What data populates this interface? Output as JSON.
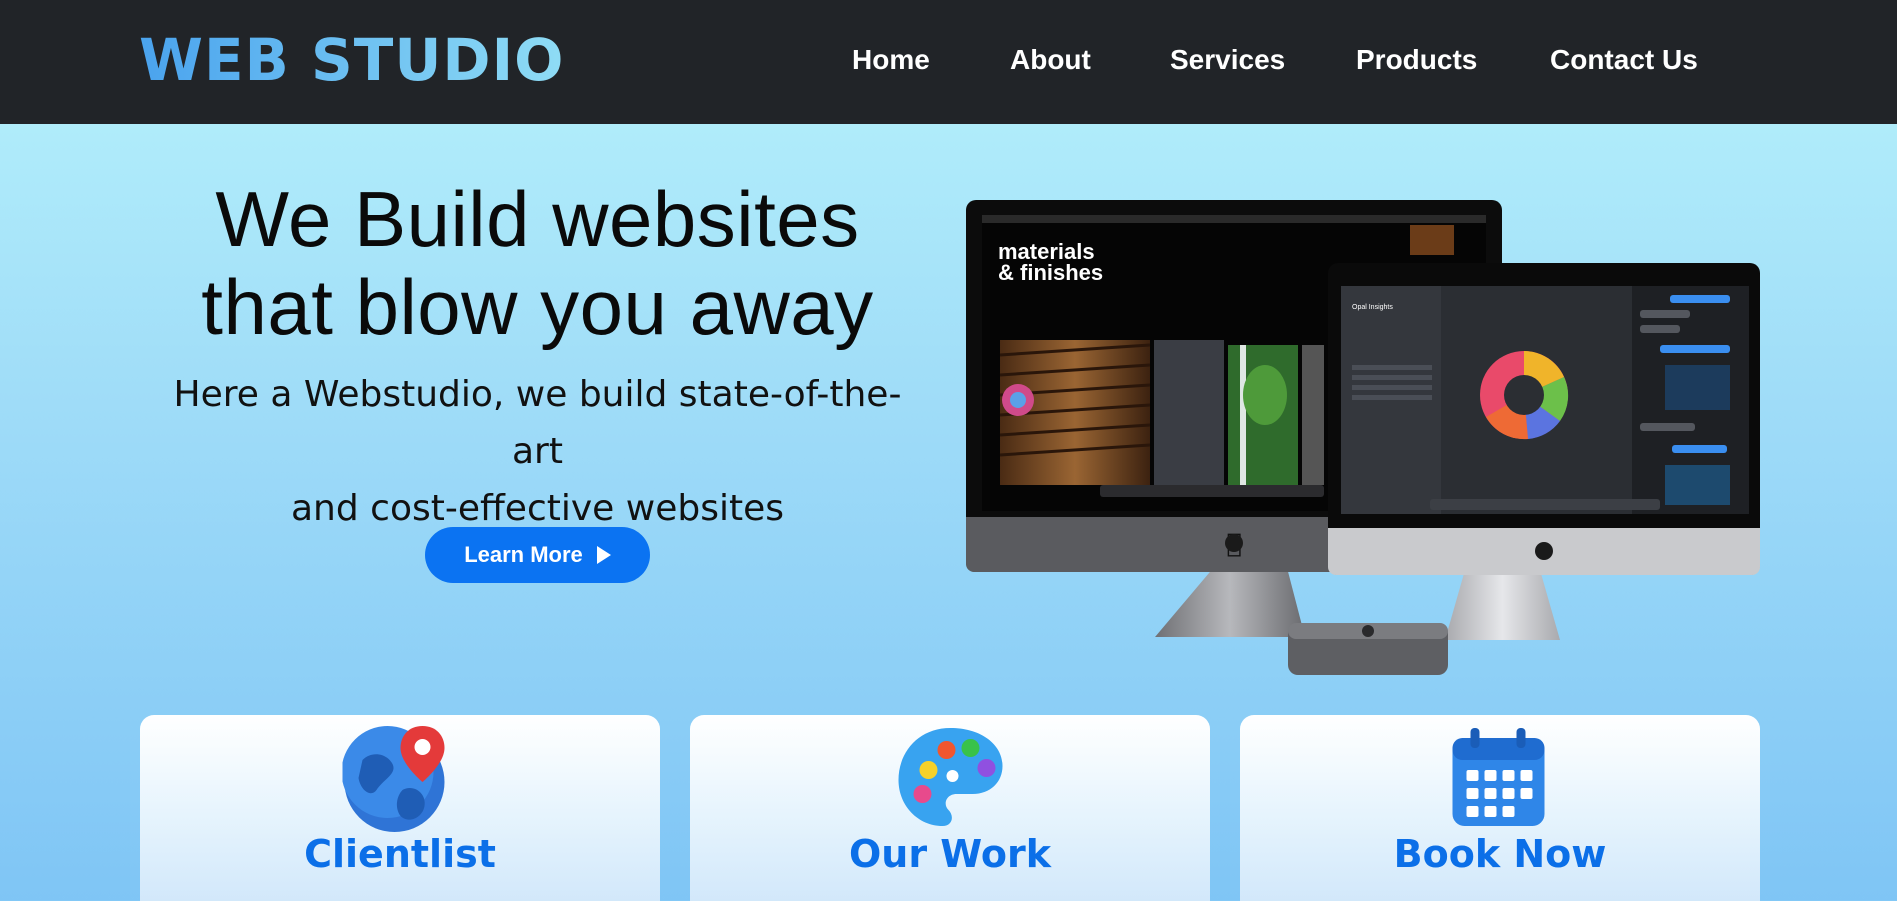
{
  "brand": {
    "name": "WEB STUDIO"
  },
  "nav": {
    "items": [
      {
        "label": "Home"
      },
      {
        "label": "About"
      },
      {
        "label": "Services"
      },
      {
        "label": "Products"
      },
      {
        "label": "Contact Us"
      }
    ]
  },
  "hero": {
    "title_line1": "We Build websites",
    "title_line2": "that blow you away",
    "subtitle_line1": "Here a Webstudio, we build state-of-the-art",
    "subtitle_line2": "and cost-effective websites",
    "cta_label": "Learn More",
    "image": {
      "screen_heading_line1": "materials",
      "screen_heading_line2": "& finishes",
      "chart_title": "Opal Insights"
    }
  },
  "cards": [
    {
      "title": "Clientlist",
      "icon": "globe-pin-icon"
    },
    {
      "title": "Our Work",
      "icon": "palette-icon"
    },
    {
      "title": "Book Now",
      "icon": "calendar-icon"
    }
  ],
  "colors": {
    "navbar_bg": "#212428",
    "accent": "#0b73f2",
    "card_title": "#0b6fe8"
  }
}
